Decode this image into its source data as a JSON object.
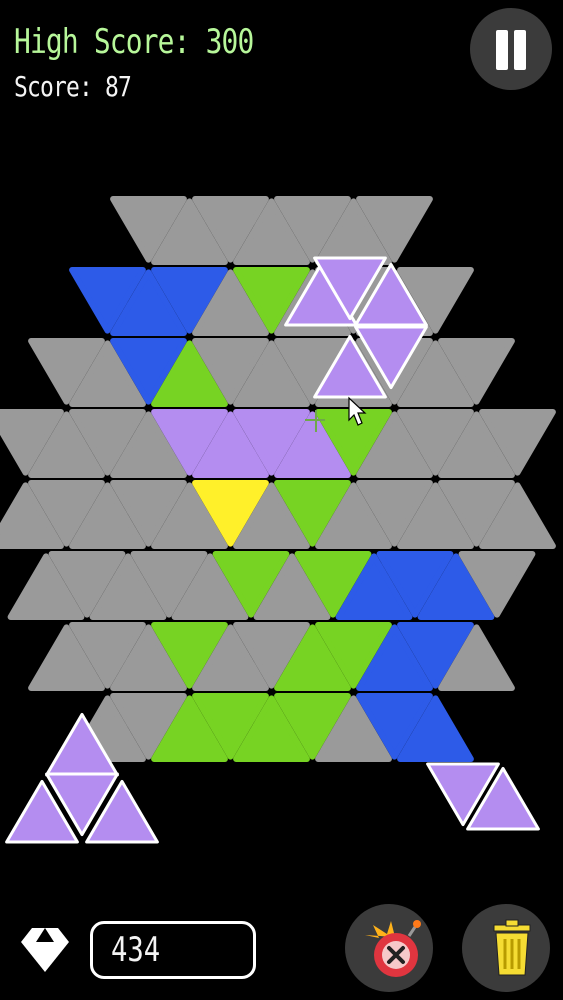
{
  "hud": {
    "high_score_label": "High Score: 300",
    "score_label": "Score: 87",
    "gem_count": "434"
  },
  "colors": {
    "empty": "#9a9a9a",
    "blue": "#2d5be8",
    "green": "#77d323",
    "purple": "#b48df0",
    "yellow": "#fff02a",
    "high_score_text": "#b7f79a",
    "button_bg": "#3b3b3b"
  },
  "icons": {
    "pause": "pause-icon",
    "gem": "diamond-icon",
    "bomb": "bomb-icon",
    "trash": "trash-can-icon"
  },
  "board": {
    "shape": "hexagon",
    "rows": [
      "eeeeeee",
      "bbbegeeee",
      "eebgeeeeeee",
      "eeeeppppgeeee",
      "eeeeeyegeeeee",
      "eeeeegegbbbe",
      "eeegeeggbbe",
      "eeggggebb"
    ]
  },
  "drag_piece": {
    "color": "purple",
    "cells": 5
  },
  "tray": [
    {
      "name": "tray-piece-left",
      "color": "purple",
      "cells": 4
    },
    {
      "name": "tray-piece-right",
      "color": "purple",
      "cells": 2
    }
  ]
}
